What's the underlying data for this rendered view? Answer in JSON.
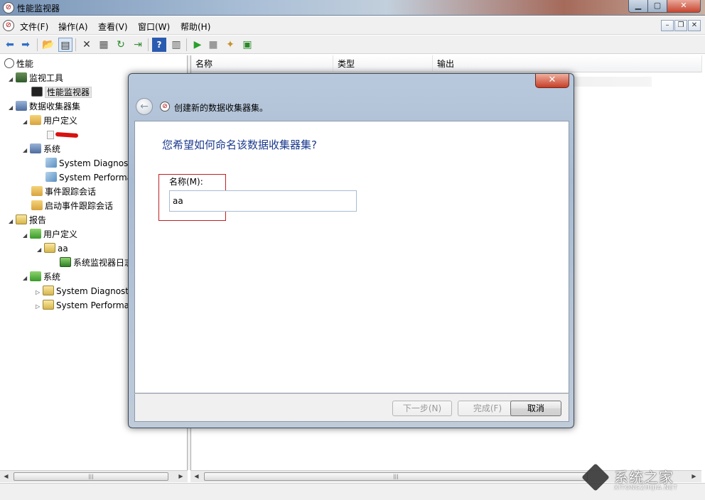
{
  "window": {
    "title": "性能监视器"
  },
  "menu": [
    "文件(F)",
    "操作(A)",
    "查看(V)",
    "窗口(W)",
    "帮助(H)"
  ],
  "tree": {
    "root": "性能",
    "monitoring_tools": "监视工具",
    "perf_monitor": "性能监视器",
    "data_collector_sets": "数据收集器集",
    "user_defined": "用户定义",
    "system": "系统",
    "sys_diag": "System Diagnost",
    "sys_perf": "System Performa",
    "event_trace": "事件跟踪会话",
    "startup_event_trace": "启动事件跟踪会话",
    "reports": "报告",
    "report_user_defined": "用户定义",
    "report_aa": "aa",
    "report_log": "系统监视器日志",
    "report_system": "系统",
    "report_sys_diag": "System Diagnost",
    "report_sys_perf": "System Performa"
  },
  "list": {
    "columns": [
      "名称",
      "类型",
      "输出"
    ]
  },
  "dialog": {
    "title": "创建新的数据收集器集。",
    "question": "您希望如何命名该数据收集器集?",
    "name_label": "名称(M):",
    "name_value": "aa",
    "buttons": {
      "next": "下一步(N)",
      "finish": "完成(F)",
      "cancel": "取消"
    }
  },
  "watermark": {
    "text": "系统之家",
    "url": "XITONGZHIJIA.NET"
  }
}
